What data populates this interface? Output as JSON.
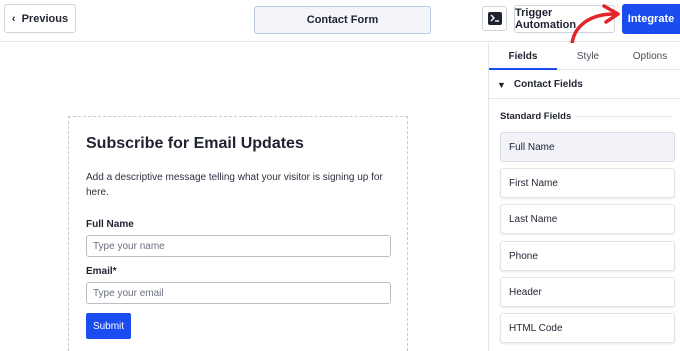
{
  "topbar": {
    "previous_label": "Previous",
    "form_name": "Contact Form",
    "trigger_label": "Trigger Automation",
    "integrate_label": "Integrate"
  },
  "form": {
    "title": "Subscribe for Email Updates",
    "description": "Add a descriptive message telling what your visitor is signing up for here.",
    "fields": [
      {
        "label": "Full Name",
        "placeholder": "Type your name"
      },
      {
        "label": "Email*",
        "placeholder": "Type your email"
      }
    ],
    "submit_label": "Submit"
  },
  "panel": {
    "tabs": [
      "Fields",
      "Style",
      "Options"
    ],
    "section_title": "Contact Fields",
    "standard_label": "Standard Fields",
    "items": [
      "Full Name",
      "First Name",
      "Last Name",
      "Phone",
      "Header",
      "HTML Code"
    ]
  },
  "colors": {
    "accent": "#1a4cf0",
    "annotation_arrow": "#e3262b"
  }
}
